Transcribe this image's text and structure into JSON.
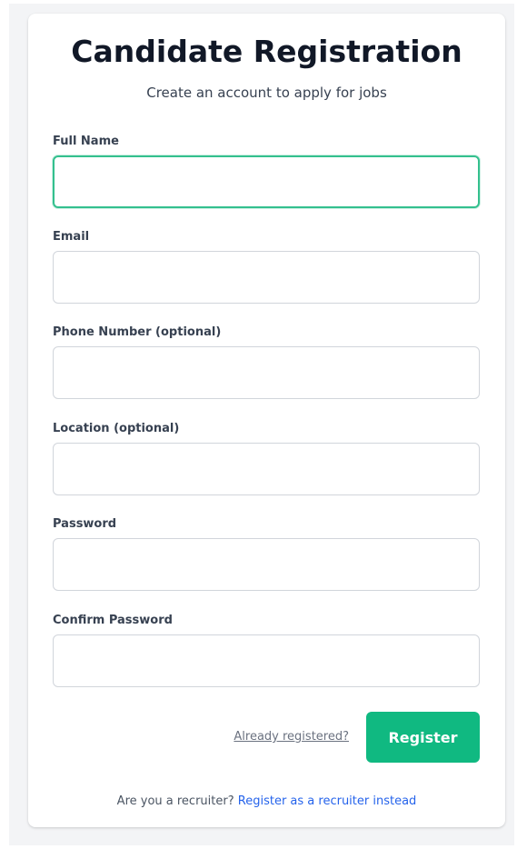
{
  "colors": {
    "accent": "#10b981",
    "focus_border": "#34c08e",
    "link": "#2563eb",
    "page_background": "#f3f4f6"
  },
  "form": {
    "title": "Candidate Registration",
    "subtitle": "Create an account to apply for jobs",
    "fields": [
      {
        "label": "Full Name",
        "value": "",
        "focused": true
      },
      {
        "label": "Email",
        "value": ""
      },
      {
        "label": "Phone Number (optional)",
        "value": ""
      },
      {
        "label": "Location (optional)",
        "value": ""
      },
      {
        "label": "Password",
        "value": ""
      },
      {
        "label": "Confirm Password",
        "value": ""
      }
    ],
    "login_link": "Already registered?",
    "submit_label": "Register"
  },
  "footer": {
    "prompt": "Are you a recruiter?",
    "link": "Register as a recruiter instead"
  }
}
